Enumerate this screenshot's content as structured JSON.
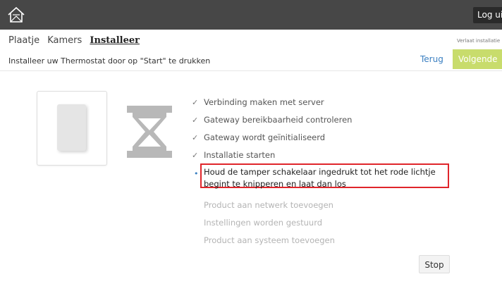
{
  "header": {
    "logout_label": "Log uit"
  },
  "nav": {
    "items": [
      "Plaatje",
      "Kamers"
    ],
    "active": "Installeer"
  },
  "skip_label": "Verlaat installatie",
  "subtitle": "Installeer uw Thermostat door op \"Start\" te drukken",
  "actions": {
    "back_label": "Terug",
    "next_label": "Volgende",
    "stop_label": "Stop"
  },
  "steps": {
    "done": [
      "Verbinding maken met server",
      "Gateway bereikbaarheid controleren",
      "Gateway wordt geïnitialiseerd",
      "Installatie starten"
    ],
    "current_line1": "Houd de tamper schakelaar ingedrukt tot het rode lichtje",
    "current_line2": "begint te knipperen en laat dan los",
    "pending": [
      "Product aan netwerk toevoegen",
      "Instellingen worden gestuurd",
      "Product aan systeem toevoegen"
    ],
    "check_mark": "✓",
    "current_marker": "•"
  },
  "colors": {
    "topbar": "#474747",
    "accent_next": "#c8dc6c",
    "link": "#3a7fc1",
    "highlight_border": "#e0252b"
  }
}
